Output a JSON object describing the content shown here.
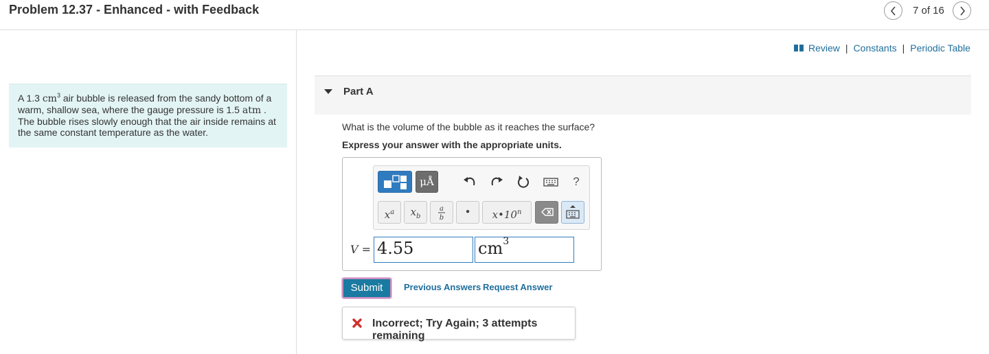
{
  "header": {
    "problem_title": "Problem 12.37 - Enhanced - with Feedback",
    "nav_count": "7 of 16"
  },
  "problem": {
    "text_a": "A 1.3",
    "unit_cm": "cm",
    "unit_cm_exp": "3",
    "text_b": " air bubble is released from the sandy bottom of a warm, shallow sea, where the gauge pressure is 1.5",
    "unit_atm": "atm",
    "text_c": " . The bubble rises slowly enough that the air inside remains at the same constant temperature as the water."
  },
  "links": {
    "review": "Review",
    "constants": "Constants",
    "periodic_table": "Periodic Table",
    "separator": "|"
  },
  "part": {
    "label": "Part A",
    "question": "What is the volume of the bubble as it reaches the surface?",
    "instruction": "Express your answer with the appropriate units."
  },
  "toolbar": {
    "symbols_label": "μÅ",
    "help_label": "?",
    "superscript_label": "xa",
    "subscript_label": "xb",
    "fraction_num": "a",
    "fraction_den": "b",
    "dot_label": "•",
    "sci_label": "x•10n"
  },
  "answer": {
    "variable": "V",
    "equals": "=",
    "value": "4.55",
    "unit": "cm",
    "unit_exp": "3"
  },
  "actions": {
    "submit": "Submit",
    "previous_answers": "Previous Answers",
    "request_answer": "Request Answer"
  },
  "feedback": {
    "message": "Incorrect; Try Again; 3 attempts remaining"
  },
  "colors": {
    "link": "#1f6e9c",
    "submit": "#1a7aa1",
    "problem_bg": "#e3f4f4",
    "error_red": "#d0312d",
    "template_blue": "#2f7bbf"
  }
}
